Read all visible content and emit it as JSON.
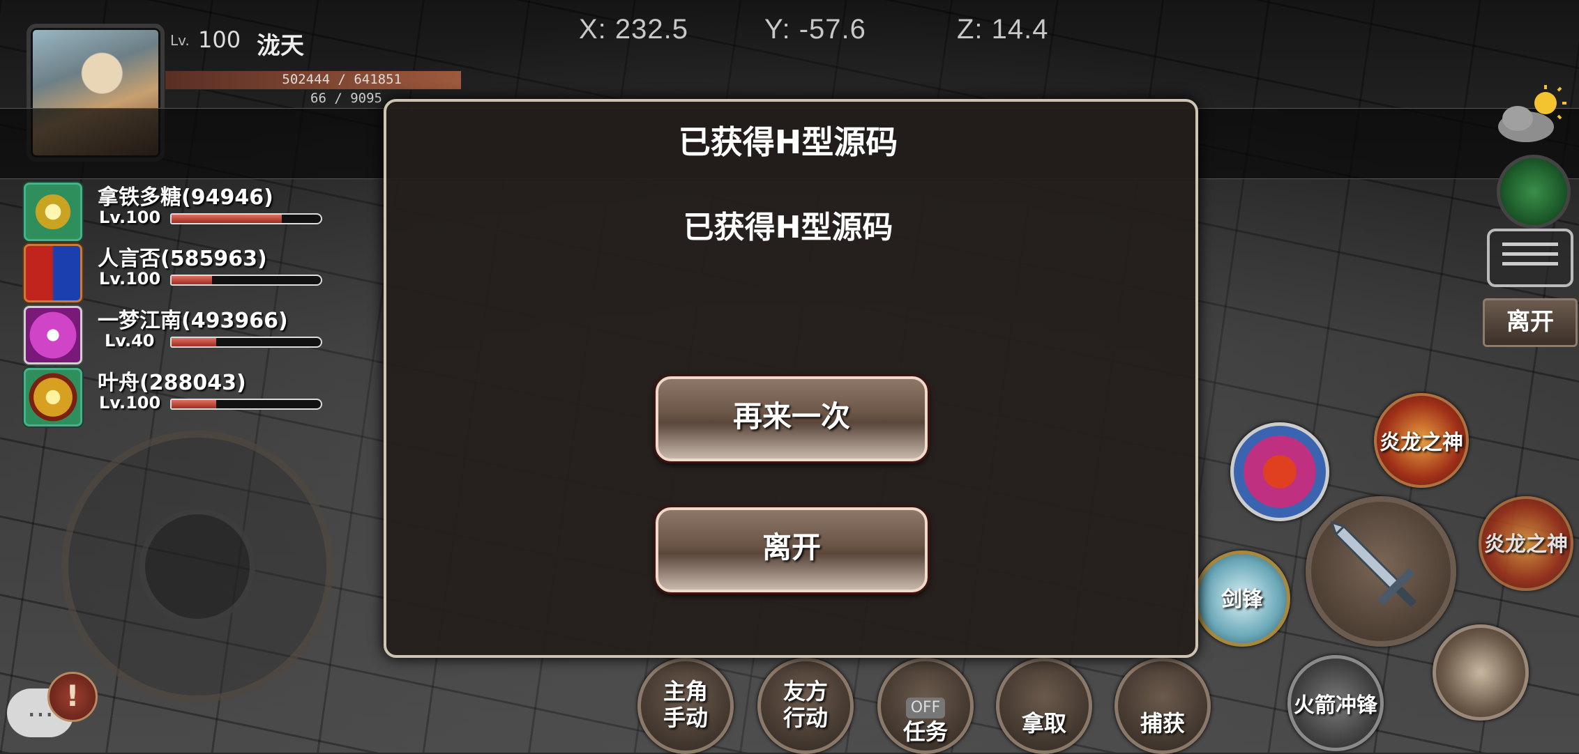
{
  "hud": {
    "level_prefix": "Lv.",
    "level": "100",
    "player_name": "泷天",
    "hp_text": "502444 / 641851",
    "hp_fraction": 0.78,
    "mp_text": "66 / 9095"
  },
  "coords": {
    "x": "X: 232.5",
    "y": "Y: -57.6",
    "z": "Z: 14.4"
  },
  "party": [
    {
      "name": "拿铁多糖(94946)",
      "level": "Lv.100",
      "hp_fraction": 0.74
    },
    {
      "name": "人言否(585963)",
      "level": "Lv.100",
      "hp_fraction": 0.27
    },
    {
      "name": "一梦江南(493966)",
      "level": "Lv.40",
      "hp_fraction": 0.3
    },
    {
      "name": "叶舟(288043)",
      "level": "Lv.100",
      "hp_fraction": 0.3
    }
  ],
  "dialog": {
    "title": "已获得H型源码",
    "message": "已获得H型源码",
    "retry_label": "再来一次",
    "leave_label": "离开"
  },
  "right_panel": {
    "leave_label": "离开"
  },
  "skills": {
    "flame_dragon_1": "炎龙之神",
    "flame_dragon_2": "炎龙之神",
    "sword_edge": "剑锋",
    "rocket_charge": "火箭冲锋"
  },
  "actions": {
    "leader_manual_1": "主角",
    "leader_manual_2": "手动",
    "ally_action_1": "友方",
    "ally_action_2": "行动",
    "quest_off_tag": "OFF",
    "quest": "任务",
    "take": "拿取",
    "capture": "捕获"
  },
  "chat": {
    "icon": "...",
    "alert_icon": "!"
  }
}
